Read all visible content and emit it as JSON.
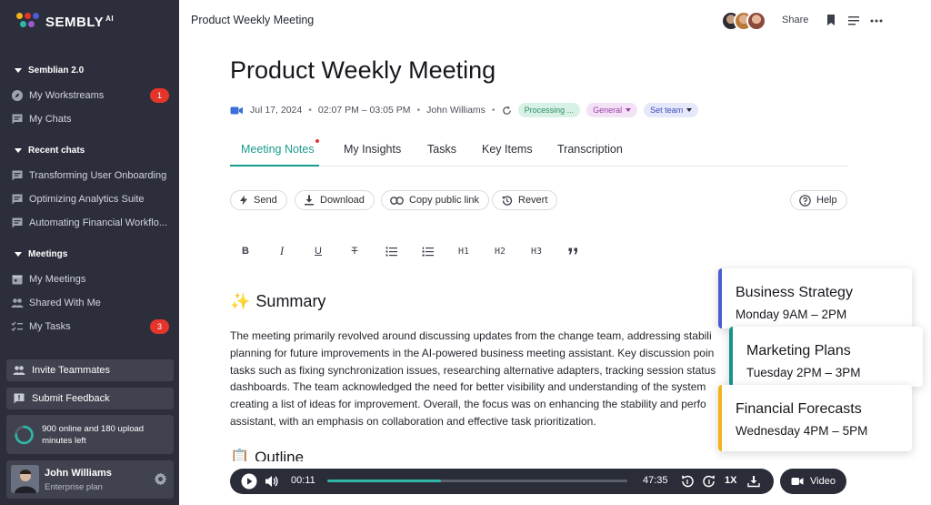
{
  "app": {
    "logo_text": "SEMBLY",
    "logo_sup": "AI"
  },
  "colors": {
    "sidebar_bg": "#2c2f3b",
    "accent_teal": "#1a9c8c",
    "badge_red": "#e5352b",
    "card_blue": "#4a5bd4",
    "card_teal": "#16948a",
    "card_yellow": "#f2b319"
  },
  "sidebar": {
    "sections": [
      {
        "label": "Semblian 2.0"
      },
      {
        "label": "Recent chats"
      },
      {
        "label": "Meetings"
      }
    ],
    "semblian_items": [
      {
        "label": "My Workstreams",
        "icon": "compass-icon",
        "badge": "1"
      },
      {
        "label": "My Chats",
        "icon": "chat-icon"
      }
    ],
    "recent_chats": [
      {
        "label": "Transforming User Onboarding",
        "icon": "chat-icon"
      },
      {
        "label": "Optimizing Analytics Suite",
        "icon": "chat-icon"
      },
      {
        "label": "Automating Financial Workflo...",
        "icon": "chat-icon"
      }
    ],
    "meeting_items": [
      {
        "label": "My Meetings",
        "icon": "calendar-icon"
      },
      {
        "label": "Shared With Me",
        "icon": "people-icon"
      },
      {
        "label": "My Tasks",
        "icon": "checklist-icon",
        "badge": "3"
      }
    ],
    "invite_label": "Invite Teammates",
    "feedback_label": "Submit Feedback",
    "usage_text": "900 online and 180 upload minutes left",
    "usage_progress": 0.75,
    "user": {
      "name": "John Williams",
      "plan": "Enterprise plan"
    }
  },
  "topbar": {
    "title": "Product Weekly Meeting",
    "share_label": "Share"
  },
  "meeting": {
    "title": "Product Weekly Meeting",
    "date": "Jul 17, 2024",
    "time": "02:07 PM – 03:05 PM",
    "owner": "John Williams",
    "status_tag": "Processing ...",
    "folder_tag": "General",
    "team_tag": "Set team",
    "meta_sep": "•"
  },
  "tabs": [
    {
      "label": "Meeting Notes"
    },
    {
      "label": "My Insights"
    },
    {
      "label": "Tasks"
    },
    {
      "label": "Key Items"
    },
    {
      "label": "Transcription"
    }
  ],
  "actions": {
    "send": "Send",
    "download": "Download",
    "copy_link": "Copy public link",
    "revert": "Revert",
    "help": "Help"
  },
  "format": {
    "h1": "H1",
    "h2": "H2",
    "h3": "H3"
  },
  "summary": {
    "emoji": "✨",
    "heading": "Summary",
    "lines": [
      "The meeting primarily revolved around discussing updates from the change team, addressing stabili",
      "planning for future improvements in the AI-powered business meeting assistant. Key discussion poin",
      "tasks such as fixing synchronization issues, researching alternative adapters, tracking session status",
      "dashboards. The team acknowledged the need for better visibility and understanding of the system",
      "creating a list of ideas for improvement. Overall, the focus was on enhancing the stability and perfo",
      "assistant, with an emphasis on collaboration and effective task prioritization."
    ]
  },
  "outline": {
    "emoji": "📋",
    "heading": "Outline"
  },
  "cards": [
    {
      "title": "Business Strategy",
      "time": "Monday 9AM – 2PM"
    },
    {
      "title": "Marketing Plans",
      "time": "Tuesday 2PM – 3PM"
    },
    {
      "title": "Financial Forecasts",
      "time": "Wednesday 4PM – 5PM"
    }
  ],
  "player": {
    "current": "00:11",
    "duration": "47:35",
    "speed": "1X",
    "progress": 0.38,
    "video_label": "Video"
  }
}
